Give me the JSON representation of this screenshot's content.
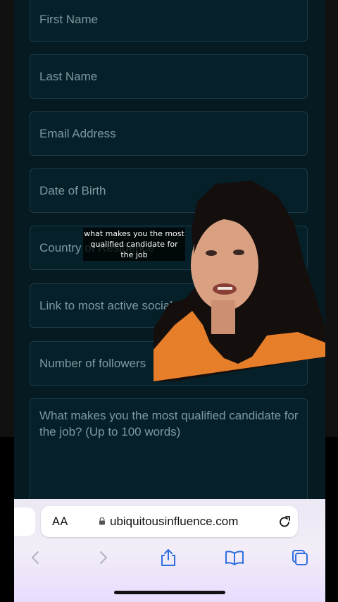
{
  "form": {
    "first_name": "First Name",
    "last_name": "Last Name",
    "email": "Email Address",
    "dob": "Date of Birth",
    "country": "Country of Residence",
    "social_link": "Link to most active social",
    "followers": "Number of followers",
    "qualified": "What makes you the most qualified candidate for the job? (Up to 100 words)"
  },
  "caption": {
    "text": "what makes you the most qualified candidate for the job"
  },
  "browser": {
    "text_size_label": "AA",
    "url": "ubiquitousinfluence.com"
  },
  "icons": {
    "lock": "lock-icon",
    "reload": "reload-icon",
    "back": "chevron-left-icon",
    "forward": "chevron-right-icon",
    "share": "share-icon",
    "bookmarks": "book-icon",
    "tabs": "tabs-icon"
  },
  "colors": {
    "page_background": "#061a22",
    "field_border": "#1d3a46",
    "placeholder": "#7f97a0",
    "toolbar_accent": "#2f6fe0"
  }
}
